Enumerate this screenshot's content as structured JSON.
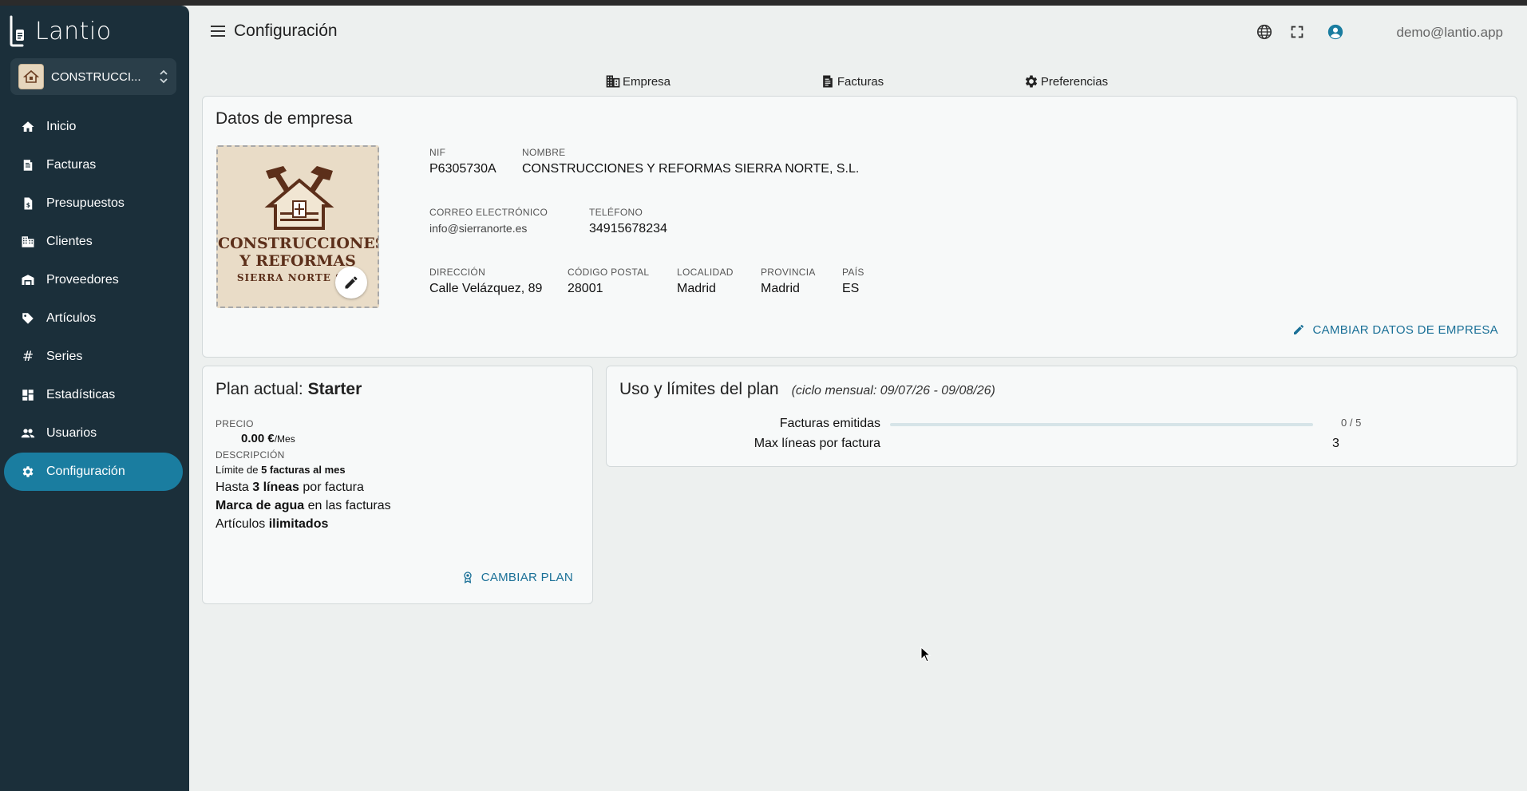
{
  "app": {
    "logo_text": "Lantio",
    "company_selector": {
      "name": "CONSTRUCCI...",
      "thumb_text": "CONSTRUCCIONES"
    }
  },
  "sidebar": {
    "items": [
      {
        "label": "Inicio",
        "icon": "home-icon"
      },
      {
        "label": "Facturas",
        "icon": "receipt-icon"
      },
      {
        "label": "Presupuestos",
        "icon": "document-dollar-icon"
      },
      {
        "label": "Clientes",
        "icon": "building-icon"
      },
      {
        "label": "Proveedores",
        "icon": "warehouse-icon"
      },
      {
        "label": "Artículos",
        "icon": "tag-icon"
      },
      {
        "label": "Series",
        "icon": "hash-icon"
      },
      {
        "label": "Estadísticas",
        "icon": "dashboard-icon"
      },
      {
        "label": "Usuarios",
        "icon": "people-icon"
      },
      {
        "label": "Configuración",
        "icon": "gear-icon",
        "active": true
      }
    ]
  },
  "header": {
    "title": "Configuración",
    "user_email": "demo@lantio.app",
    "icons": [
      "globe-icon",
      "fullscreen-icon",
      "account-icon"
    ]
  },
  "tabs": [
    {
      "label": "Empresa",
      "icon": "business-icon",
      "active": true
    },
    {
      "label": "Facturas",
      "icon": "receipt-icon",
      "active": false
    },
    {
      "label": "Preferencias",
      "icon": "gear-icon",
      "active": false
    }
  ],
  "company": {
    "title": "Datos de empresa",
    "logo": {
      "line1": "CONSTRUCCIONES",
      "line2": "Y REFORMAS",
      "line3": "SIERRA NORTE S.L."
    },
    "fields": {
      "nif": {
        "label": "NIF",
        "value": "P6305730A"
      },
      "nombre": {
        "label": "NOMBRE",
        "value": "CONSTRUCCIONES Y REFORMAS SIERRA NORTE, S.L."
      },
      "correo": {
        "label": "CORREO ELECTRÓNICO",
        "value": "info@sierranorte.es"
      },
      "telefono": {
        "label": "TELÉFONO",
        "value": "34915678234"
      },
      "direccion": {
        "label": "DIRECCIÓN",
        "value": "Calle Velázquez, 89"
      },
      "cp": {
        "label": "CÓDIGO POSTAL",
        "value": "28001"
      },
      "localidad": {
        "label": "LOCALIDAD",
        "value": "Madrid"
      },
      "provincia": {
        "label": "PROVINCIA",
        "value": "Madrid"
      },
      "pais": {
        "label": "PAÍS",
        "value": "ES"
      }
    },
    "edit_button": "CAMBIAR DATOS DE EMPRESA"
  },
  "plan": {
    "title_prefix": "Plan actual: ",
    "title_name": "Starter",
    "price_label": "PRECIO",
    "price_value": "0.00 €",
    "price_unit": "/Mes",
    "description_label": "DESCRIPCIÓN",
    "lines": [
      {
        "pre": "Límite de ",
        "bold": "5 facturas al mes",
        "post": ""
      },
      {
        "pre": "Hasta ",
        "bold": "3 líneas",
        "post": " por factura"
      },
      {
        "pre": "",
        "bold": "Marca de agua",
        "post": " en las facturas"
      },
      {
        "pre": "Artículos ",
        "bold": "ilimitados",
        "post": ""
      }
    ],
    "change_button": "CAMBIAR PLAN"
  },
  "usage": {
    "title": "Uso y límites del plan",
    "cycle": "(ciclo mensual: 09/07/26 - 09/08/26)",
    "rows": [
      {
        "label": "Facturas emitidas",
        "value": "0 / 5",
        "progress": 0
      },
      {
        "label": "Max líneas por factura",
        "value": "3"
      }
    ]
  },
  "colors": {
    "sidebar": "#1b2f3a",
    "accent": "#1a7da0",
    "link": "#1a7097"
  }
}
